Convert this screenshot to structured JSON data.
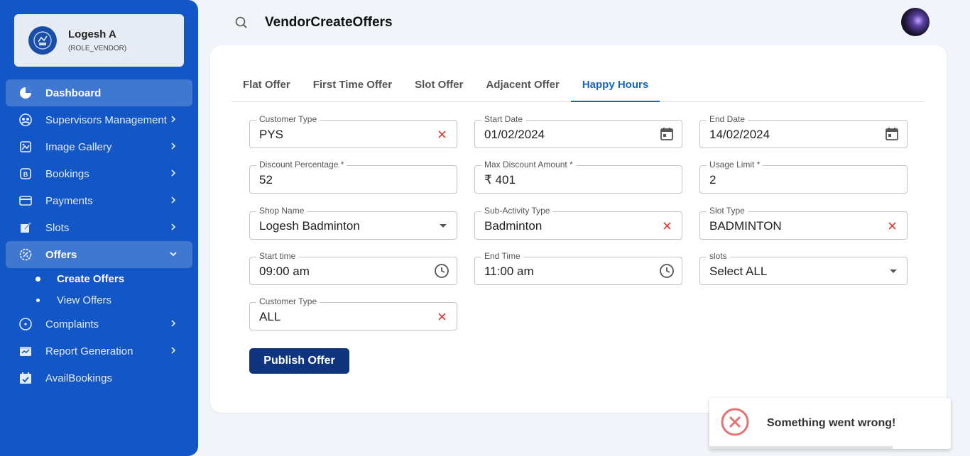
{
  "sidebar": {
    "user": {
      "name": "Logesh A",
      "role": "(ROLE_VENDOR)"
    },
    "items": [
      {
        "label": "Dashboard",
        "icon": "pie-chart-icon"
      },
      {
        "label": "Supervisors Management",
        "icon": "people-icon"
      },
      {
        "label": "Image Gallery",
        "icon": "image-gallery-icon"
      },
      {
        "label": "Bookings",
        "icon": "bookings-icon"
      },
      {
        "label": "Payments",
        "icon": "credit-card-icon"
      },
      {
        "label": "Slots",
        "icon": "edit-icon"
      },
      {
        "label": "Offers",
        "icon": "offers-icon"
      },
      {
        "label": "Complaints",
        "icon": "complaints-icon"
      },
      {
        "label": "Report Generation",
        "icon": "report-icon"
      },
      {
        "label": "AvailBookings",
        "icon": "calendar-check-icon"
      }
    ],
    "offers_sub": [
      {
        "label": "Create Offers"
      },
      {
        "label": "View Offers"
      }
    ]
  },
  "header": {
    "title": "VendorCreateOffers"
  },
  "tabs": [
    {
      "label": "Flat Offer"
    },
    {
      "label": "First Time Offer"
    },
    {
      "label": "Slot Offer"
    },
    {
      "label": "Adjacent Offer"
    },
    {
      "label": "Happy Hours"
    }
  ],
  "form": {
    "customer_type_1": {
      "label": "Customer Type",
      "value": "PYS"
    },
    "start_date": {
      "label": "Start Date",
      "value": "01/02/2024"
    },
    "end_date": {
      "label": "End Date",
      "value": "14/02/2024"
    },
    "discount_percentage": {
      "label": "Discount Percentage *",
      "value": "52"
    },
    "max_discount": {
      "label": "Max Discount Amount *",
      "value": "₹ 401"
    },
    "usage_limit": {
      "label": "Usage Limit *",
      "value": "2"
    },
    "shop_name": {
      "label": "Shop Name",
      "value": "Logesh Badminton"
    },
    "sub_activity": {
      "label": "Sub-Activity Type",
      "value": "Badminton"
    },
    "slot_type": {
      "label": "Slot Type",
      "value": "BADMINTON"
    },
    "start_time": {
      "label": "Start time",
      "value": "09:00 am"
    },
    "end_time": {
      "label": "End Time",
      "value": "11:00 am"
    },
    "slots": {
      "label": "slots",
      "value": "Select ALL"
    },
    "customer_type_2": {
      "label": "Customer Type",
      "value": "ALL"
    }
  },
  "publish_label": "Publish Offer",
  "toast": {
    "message": "Something went wrong!",
    "progress_fraction": 0.76
  },
  "colors": {
    "sidebar": "#1356c5",
    "accent": "#1565c0",
    "button": "#10357f",
    "error": "#e53935"
  }
}
